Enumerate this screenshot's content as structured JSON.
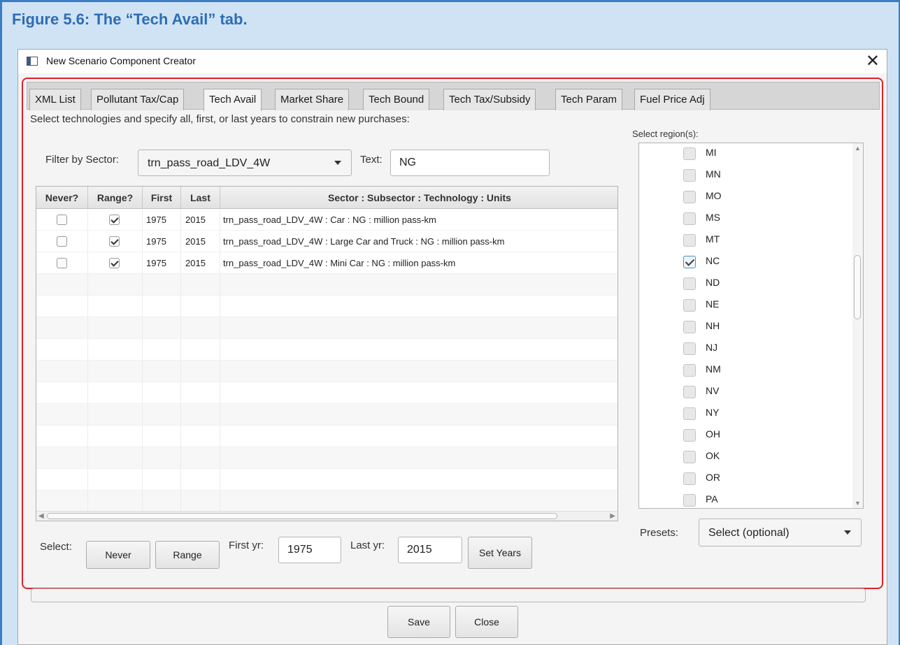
{
  "figure": {
    "caption": "Figure 5.6: The “Tech Avail” tab."
  },
  "window": {
    "title": "New Scenario Component Creator",
    "close": "✕"
  },
  "tabs": [
    {
      "label": "XML List"
    },
    {
      "label": "Pollutant Tax/Cap"
    },
    {
      "label": "Tech Avail",
      "active": true
    },
    {
      "label": "Market Share"
    },
    {
      "label": "Tech Bound"
    },
    {
      "label": "Tech Tax/Subsidy"
    },
    {
      "label": "Tech Param"
    },
    {
      "label": "Fuel Price Adj"
    }
  ],
  "main": {
    "instructions": "Select technologies and specify all, first, or last years to constrain new purchases:",
    "filter_label": "Filter by Sector:",
    "filter_value": "trn_pass_road_LDV_4W",
    "text_label": "Text:",
    "text_value": "NG"
  },
  "table": {
    "headers": [
      "Never?",
      "Range?",
      "First",
      "Last",
      "Sector : Subsector : Technology : Units"
    ],
    "rows": [
      {
        "never": false,
        "range": true,
        "first": "1975",
        "last": "2015",
        "desc": "trn_pass_road_LDV_4W : Car : NG : million pass-km"
      },
      {
        "never": false,
        "range": true,
        "first": "1975",
        "last": "2015",
        "desc": "trn_pass_road_LDV_4W : Large Car and Truck : NG : million pass-km"
      },
      {
        "never": false,
        "range": true,
        "first": "1975",
        "last": "2015",
        "desc": "trn_pass_road_LDV_4W : Mini Car : NG : million pass-km"
      }
    ]
  },
  "bottom": {
    "select_label": "Select:",
    "never_btn": "Never",
    "range_btn": "Range",
    "first_yr_label": "First yr:",
    "first_yr_value": "1975",
    "last_yr_label": "Last yr:",
    "last_yr_value": "2015",
    "set_years_btn": "Set Years"
  },
  "regions": {
    "label": "Select region(s):",
    "items": [
      {
        "name": "MI",
        "checked": false
      },
      {
        "name": "MN",
        "checked": false
      },
      {
        "name": "MO",
        "checked": false
      },
      {
        "name": "MS",
        "checked": false
      },
      {
        "name": "MT",
        "checked": false
      },
      {
        "name": "NC",
        "checked": true
      },
      {
        "name": "ND",
        "checked": false
      },
      {
        "name": "NE",
        "checked": false
      },
      {
        "name": "NH",
        "checked": false
      },
      {
        "name": "NJ",
        "checked": false
      },
      {
        "name": "NM",
        "checked": false
      },
      {
        "name": "NV",
        "checked": false
      },
      {
        "name": "NY",
        "checked": false
      },
      {
        "name": "OH",
        "checked": false
      },
      {
        "name": "OK",
        "checked": false
      },
      {
        "name": "OR",
        "checked": false
      },
      {
        "name": "PA",
        "checked": false
      }
    ],
    "presets_label": "Presets:",
    "presets_value": "Select (optional)"
  },
  "footer": {
    "save": "Save",
    "close": "Close"
  },
  "colors": {
    "highlight_frame": "#e0202a",
    "caption_text": "#2e6cb3",
    "caption_bg": "#cfe3f4"
  }
}
